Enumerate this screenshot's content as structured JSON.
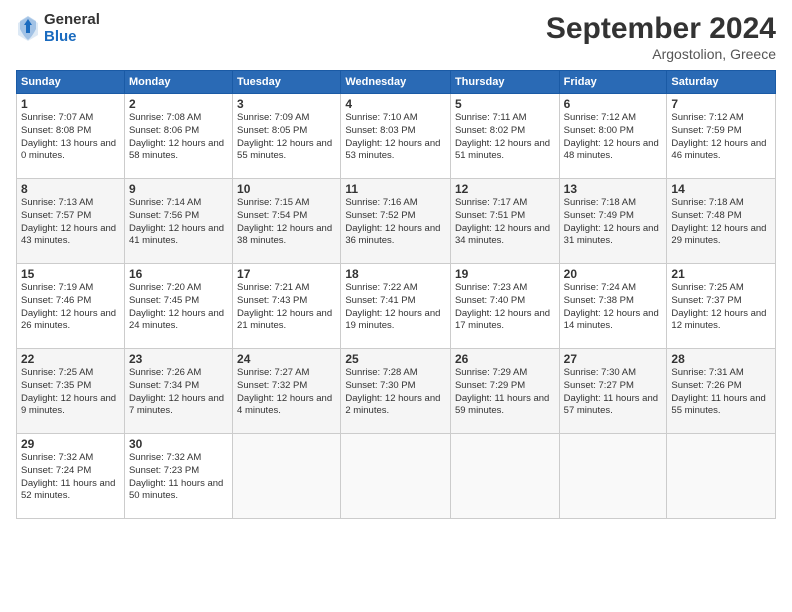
{
  "header": {
    "logo_general": "General",
    "logo_blue": "Blue",
    "month": "September 2024",
    "location": "Argostolion, Greece"
  },
  "days_of_week": [
    "Sunday",
    "Monday",
    "Tuesday",
    "Wednesday",
    "Thursday",
    "Friday",
    "Saturday"
  ],
  "weeks": [
    [
      {
        "day": "1",
        "sunrise": "7:07 AM",
        "sunset": "8:08 PM",
        "daylight": "13 hours and 0 minutes."
      },
      {
        "day": "2",
        "sunrise": "7:08 AM",
        "sunset": "8:06 PM",
        "daylight": "12 hours and 58 minutes."
      },
      {
        "day": "3",
        "sunrise": "7:09 AM",
        "sunset": "8:05 PM",
        "daylight": "12 hours and 55 minutes."
      },
      {
        "day": "4",
        "sunrise": "7:10 AM",
        "sunset": "8:03 PM",
        "daylight": "12 hours and 53 minutes."
      },
      {
        "day": "5",
        "sunrise": "7:11 AM",
        "sunset": "8:02 PM",
        "daylight": "12 hours and 51 minutes."
      },
      {
        "day": "6",
        "sunrise": "7:12 AM",
        "sunset": "8:00 PM",
        "daylight": "12 hours and 48 minutes."
      },
      {
        "day": "7",
        "sunrise": "7:12 AM",
        "sunset": "7:59 PM",
        "daylight": "12 hours and 46 minutes."
      }
    ],
    [
      {
        "day": "8",
        "sunrise": "7:13 AM",
        "sunset": "7:57 PM",
        "daylight": "12 hours and 43 minutes."
      },
      {
        "day": "9",
        "sunrise": "7:14 AM",
        "sunset": "7:56 PM",
        "daylight": "12 hours and 41 minutes."
      },
      {
        "day": "10",
        "sunrise": "7:15 AM",
        "sunset": "7:54 PM",
        "daylight": "12 hours and 38 minutes."
      },
      {
        "day": "11",
        "sunrise": "7:16 AM",
        "sunset": "7:52 PM",
        "daylight": "12 hours and 36 minutes."
      },
      {
        "day": "12",
        "sunrise": "7:17 AM",
        "sunset": "7:51 PM",
        "daylight": "12 hours and 34 minutes."
      },
      {
        "day": "13",
        "sunrise": "7:18 AM",
        "sunset": "7:49 PM",
        "daylight": "12 hours and 31 minutes."
      },
      {
        "day": "14",
        "sunrise": "7:18 AM",
        "sunset": "7:48 PM",
        "daylight": "12 hours and 29 minutes."
      }
    ],
    [
      {
        "day": "15",
        "sunrise": "7:19 AM",
        "sunset": "7:46 PM",
        "daylight": "12 hours and 26 minutes."
      },
      {
        "day": "16",
        "sunrise": "7:20 AM",
        "sunset": "7:45 PM",
        "daylight": "12 hours and 24 minutes."
      },
      {
        "day": "17",
        "sunrise": "7:21 AM",
        "sunset": "7:43 PM",
        "daylight": "12 hours and 21 minutes."
      },
      {
        "day": "18",
        "sunrise": "7:22 AM",
        "sunset": "7:41 PM",
        "daylight": "12 hours and 19 minutes."
      },
      {
        "day": "19",
        "sunrise": "7:23 AM",
        "sunset": "7:40 PM",
        "daylight": "12 hours and 17 minutes."
      },
      {
        "day": "20",
        "sunrise": "7:24 AM",
        "sunset": "7:38 PM",
        "daylight": "12 hours and 14 minutes."
      },
      {
        "day": "21",
        "sunrise": "7:25 AM",
        "sunset": "7:37 PM",
        "daylight": "12 hours and 12 minutes."
      }
    ],
    [
      {
        "day": "22",
        "sunrise": "7:25 AM",
        "sunset": "7:35 PM",
        "daylight": "12 hours and 9 minutes."
      },
      {
        "day": "23",
        "sunrise": "7:26 AM",
        "sunset": "7:34 PM",
        "daylight": "12 hours and 7 minutes."
      },
      {
        "day": "24",
        "sunrise": "7:27 AM",
        "sunset": "7:32 PM",
        "daylight": "12 hours and 4 minutes."
      },
      {
        "day": "25",
        "sunrise": "7:28 AM",
        "sunset": "7:30 PM",
        "daylight": "12 hours and 2 minutes."
      },
      {
        "day": "26",
        "sunrise": "7:29 AM",
        "sunset": "7:29 PM",
        "daylight": "11 hours and 59 minutes."
      },
      {
        "day": "27",
        "sunrise": "7:30 AM",
        "sunset": "7:27 PM",
        "daylight": "11 hours and 57 minutes."
      },
      {
        "day": "28",
        "sunrise": "7:31 AM",
        "sunset": "7:26 PM",
        "daylight": "11 hours and 55 minutes."
      }
    ],
    [
      {
        "day": "29",
        "sunrise": "7:32 AM",
        "sunset": "7:24 PM",
        "daylight": "11 hours and 52 minutes."
      },
      {
        "day": "30",
        "sunrise": "7:32 AM",
        "sunset": "7:23 PM",
        "daylight": "11 hours and 50 minutes."
      },
      null,
      null,
      null,
      null,
      null
    ]
  ]
}
